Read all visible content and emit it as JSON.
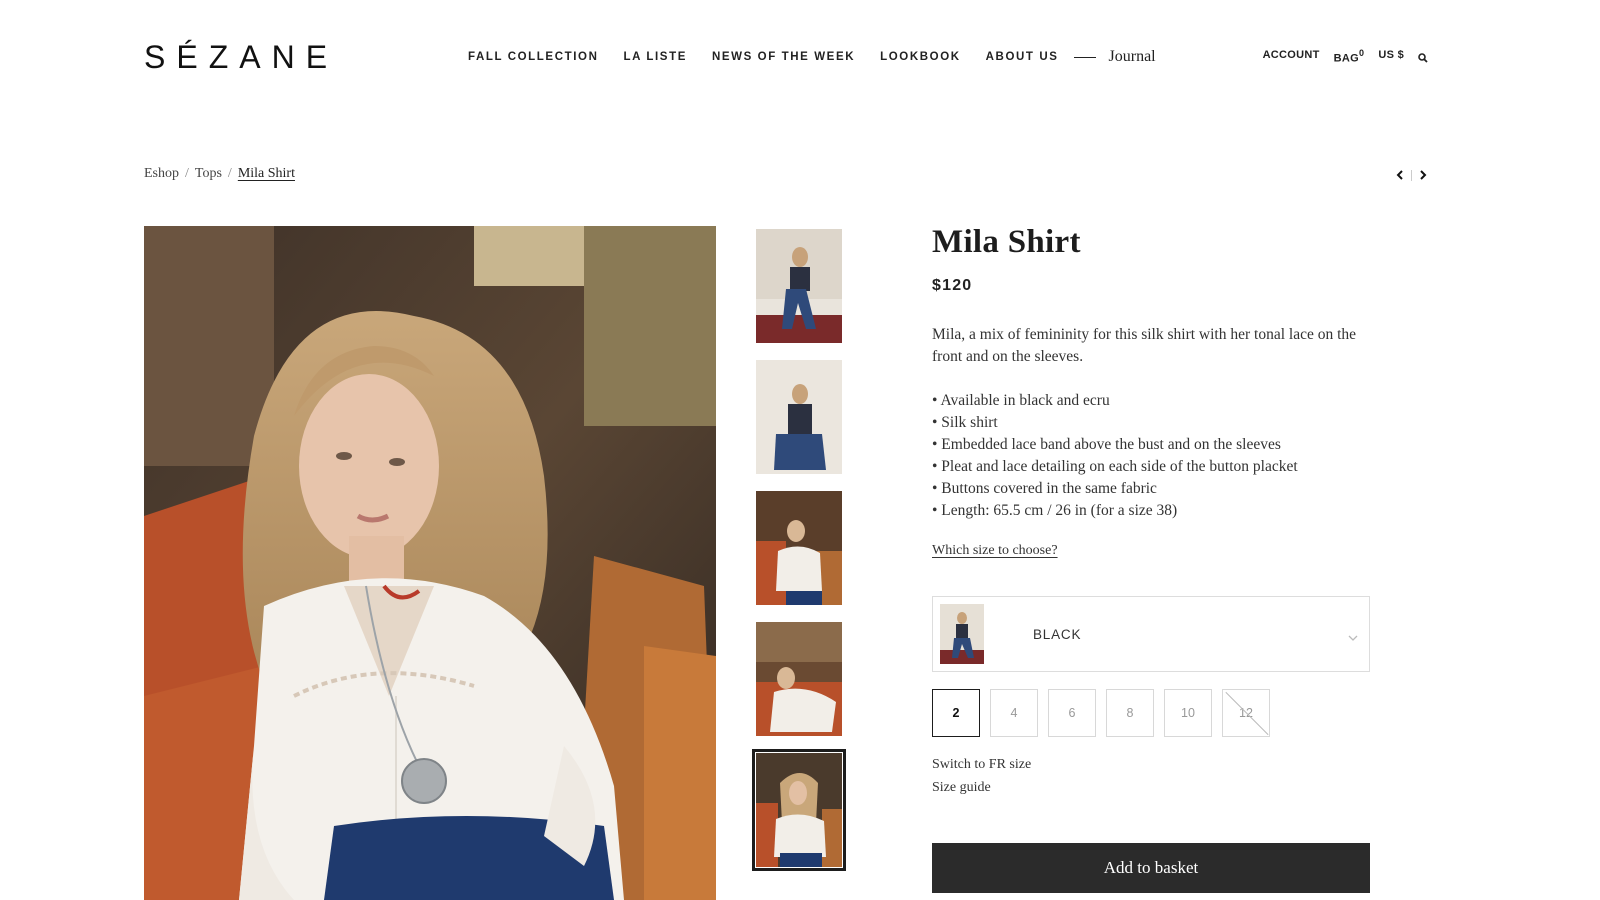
{
  "header": {
    "logo": "SÉZANE",
    "nav": [
      "FALL COLLECTION",
      "LA LISTE",
      "NEWS OF THE WEEK",
      "LOOKBOOK",
      "ABOUT US"
    ],
    "journal": "Journal",
    "account": "ACCOUNT",
    "bag_label": "BAG",
    "bag_count": "0",
    "currency": "US $"
  },
  "breadcrumb": {
    "items": [
      "Eshop",
      "Tops",
      "Mila Shirt"
    ],
    "sep": "/"
  },
  "product": {
    "title": "Mila Shirt",
    "price": "$120",
    "description": "Mila, a mix of femininity for this silk shirt with her tonal lace on the front and on the sleeves.",
    "features": [
      "• Available in black and ecru",
      "• Silk shirt",
      "• Embedded lace band above the bust and on the sleeves",
      "• Pleat and lace detailing on each side of the button placket",
      "• Buttons covered in the same fabric",
      "• Length: 65.5 cm / 26 in (for a size 38)"
    ],
    "size_help": "Which size to choose?",
    "color": "BLACK",
    "sizes": [
      "2",
      "4",
      "6",
      "8",
      "10",
      "12"
    ],
    "selected_size": "2",
    "unavailable_sizes": [
      "12"
    ],
    "switch_size": "Switch to FR size",
    "size_guide": "Size guide",
    "add_button": "Add to basket"
  },
  "colors": {
    "accent": "#2b2b2b",
    "background": "#ffffff",
    "text": "#1d1d1d"
  }
}
